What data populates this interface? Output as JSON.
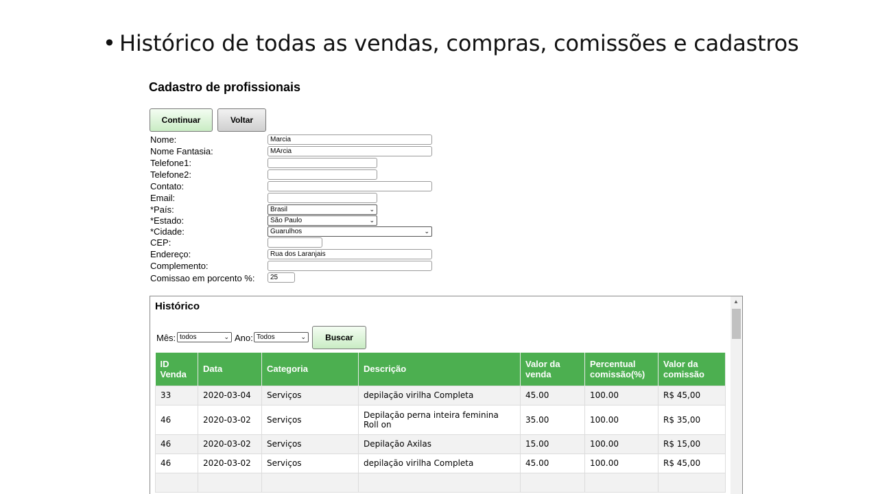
{
  "slide": {
    "bullet": "•",
    "title": "Histórico de todas as vendas, compras, comissões e cadastros"
  },
  "form": {
    "title": "Cadastro de profissionais",
    "continue_label": "Continuar",
    "back_label": "Voltar",
    "fields": {
      "nome": {
        "label": "Nome:",
        "value": "Marcia"
      },
      "nome_fantasia": {
        "label": "Nome Fantasia:",
        "value": "MArcia"
      },
      "telefone1": {
        "label": "Telefone1:",
        "value": ""
      },
      "telefone2": {
        "label": "Telefone2:",
        "value": ""
      },
      "contato": {
        "label": "Contato:",
        "value": ""
      },
      "email": {
        "label": "Email:",
        "value": ""
      },
      "pais": {
        "label": "*País:",
        "value": "Brasil"
      },
      "estado": {
        "label": "*Estado:",
        "value": "São Paulo"
      },
      "cidade": {
        "label": "*Cidade:",
        "value": "Guarulhos"
      },
      "cep": {
        "label": "CEP:",
        "value": ""
      },
      "endereco": {
        "label": "Endereço:",
        "value": "Rua dos Laranjais"
      },
      "complemento": {
        "label": "Complemento:",
        "value": ""
      },
      "comissao": {
        "label": "Comissao em porcento %:",
        "value": "25"
      }
    }
  },
  "history": {
    "title": "Histórico",
    "month_label": "Mês:",
    "month_value": "todos",
    "year_label": "Ano:",
    "year_value": "Todos",
    "search_label": "Buscar",
    "columns": [
      "ID Venda",
      "Data",
      "Categoria",
      "Descrição",
      "Valor da venda",
      "Percentual comissão(%)",
      "Valor da comissão"
    ],
    "rows": [
      [
        "33",
        "2020-03-04",
        "Serviços",
        "depilação virilha Completa",
        "45.00",
        "100.00",
        "R$ 45,00"
      ],
      [
        "46",
        "2020-03-02",
        "Serviços",
        "Depilação perna inteira feminina Roll on",
        "35.00",
        "100.00",
        "R$ 35,00"
      ],
      [
        "46",
        "2020-03-02",
        "Serviços",
        "Depilação Axilas",
        "15.00",
        "100.00",
        "R$ 15,00"
      ],
      [
        "46",
        "2020-03-02",
        "Serviços",
        "depilação virilha Completa",
        "45.00",
        "100.00",
        "R$ 45,00"
      ]
    ]
  },
  "colors": {
    "header_green": "#4caf50",
    "row_alt": "#f2f2f2",
    "button_green": "#c9ecc4"
  }
}
